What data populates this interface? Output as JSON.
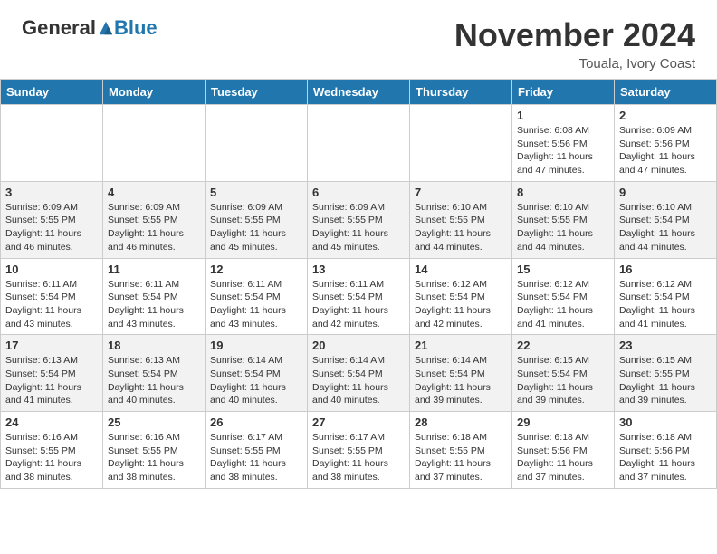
{
  "header": {
    "logo_general": "General",
    "logo_blue": "Blue",
    "month_title": "November 2024",
    "location": "Touala, Ivory Coast"
  },
  "weekdays": [
    "Sunday",
    "Monday",
    "Tuesday",
    "Wednesday",
    "Thursday",
    "Friday",
    "Saturday"
  ],
  "weeks": [
    [
      {
        "day": "",
        "info": ""
      },
      {
        "day": "",
        "info": ""
      },
      {
        "day": "",
        "info": ""
      },
      {
        "day": "",
        "info": ""
      },
      {
        "day": "",
        "info": ""
      },
      {
        "day": "1",
        "info": "Sunrise: 6:08 AM\nSunset: 5:56 PM\nDaylight: 11 hours\nand 47 minutes."
      },
      {
        "day": "2",
        "info": "Sunrise: 6:09 AM\nSunset: 5:56 PM\nDaylight: 11 hours\nand 47 minutes."
      }
    ],
    [
      {
        "day": "3",
        "info": "Sunrise: 6:09 AM\nSunset: 5:55 PM\nDaylight: 11 hours\nand 46 minutes."
      },
      {
        "day": "4",
        "info": "Sunrise: 6:09 AM\nSunset: 5:55 PM\nDaylight: 11 hours\nand 46 minutes."
      },
      {
        "day": "5",
        "info": "Sunrise: 6:09 AM\nSunset: 5:55 PM\nDaylight: 11 hours\nand 45 minutes."
      },
      {
        "day": "6",
        "info": "Sunrise: 6:09 AM\nSunset: 5:55 PM\nDaylight: 11 hours\nand 45 minutes."
      },
      {
        "day": "7",
        "info": "Sunrise: 6:10 AM\nSunset: 5:55 PM\nDaylight: 11 hours\nand 44 minutes."
      },
      {
        "day": "8",
        "info": "Sunrise: 6:10 AM\nSunset: 5:55 PM\nDaylight: 11 hours\nand 44 minutes."
      },
      {
        "day": "9",
        "info": "Sunrise: 6:10 AM\nSunset: 5:54 PM\nDaylight: 11 hours\nand 44 minutes."
      }
    ],
    [
      {
        "day": "10",
        "info": "Sunrise: 6:11 AM\nSunset: 5:54 PM\nDaylight: 11 hours\nand 43 minutes."
      },
      {
        "day": "11",
        "info": "Sunrise: 6:11 AM\nSunset: 5:54 PM\nDaylight: 11 hours\nand 43 minutes."
      },
      {
        "day": "12",
        "info": "Sunrise: 6:11 AM\nSunset: 5:54 PM\nDaylight: 11 hours\nand 43 minutes."
      },
      {
        "day": "13",
        "info": "Sunrise: 6:11 AM\nSunset: 5:54 PM\nDaylight: 11 hours\nand 42 minutes."
      },
      {
        "day": "14",
        "info": "Sunrise: 6:12 AM\nSunset: 5:54 PM\nDaylight: 11 hours\nand 42 minutes."
      },
      {
        "day": "15",
        "info": "Sunrise: 6:12 AM\nSunset: 5:54 PM\nDaylight: 11 hours\nand 41 minutes."
      },
      {
        "day": "16",
        "info": "Sunrise: 6:12 AM\nSunset: 5:54 PM\nDaylight: 11 hours\nand 41 minutes."
      }
    ],
    [
      {
        "day": "17",
        "info": "Sunrise: 6:13 AM\nSunset: 5:54 PM\nDaylight: 11 hours\nand 41 minutes."
      },
      {
        "day": "18",
        "info": "Sunrise: 6:13 AM\nSunset: 5:54 PM\nDaylight: 11 hours\nand 40 minutes."
      },
      {
        "day": "19",
        "info": "Sunrise: 6:14 AM\nSunset: 5:54 PM\nDaylight: 11 hours\nand 40 minutes."
      },
      {
        "day": "20",
        "info": "Sunrise: 6:14 AM\nSunset: 5:54 PM\nDaylight: 11 hours\nand 40 minutes."
      },
      {
        "day": "21",
        "info": "Sunrise: 6:14 AM\nSunset: 5:54 PM\nDaylight: 11 hours\nand 39 minutes."
      },
      {
        "day": "22",
        "info": "Sunrise: 6:15 AM\nSunset: 5:54 PM\nDaylight: 11 hours\nand 39 minutes."
      },
      {
        "day": "23",
        "info": "Sunrise: 6:15 AM\nSunset: 5:55 PM\nDaylight: 11 hours\nand 39 minutes."
      }
    ],
    [
      {
        "day": "24",
        "info": "Sunrise: 6:16 AM\nSunset: 5:55 PM\nDaylight: 11 hours\nand 38 minutes."
      },
      {
        "day": "25",
        "info": "Sunrise: 6:16 AM\nSunset: 5:55 PM\nDaylight: 11 hours\nand 38 minutes."
      },
      {
        "day": "26",
        "info": "Sunrise: 6:17 AM\nSunset: 5:55 PM\nDaylight: 11 hours\nand 38 minutes."
      },
      {
        "day": "27",
        "info": "Sunrise: 6:17 AM\nSunset: 5:55 PM\nDaylight: 11 hours\nand 38 minutes."
      },
      {
        "day": "28",
        "info": "Sunrise: 6:18 AM\nSunset: 5:55 PM\nDaylight: 11 hours\nand 37 minutes."
      },
      {
        "day": "29",
        "info": "Sunrise: 6:18 AM\nSunset: 5:56 PM\nDaylight: 11 hours\nand 37 minutes."
      },
      {
        "day": "30",
        "info": "Sunrise: 6:18 AM\nSunset: 5:56 PM\nDaylight: 11 hours\nand 37 minutes."
      }
    ]
  ]
}
